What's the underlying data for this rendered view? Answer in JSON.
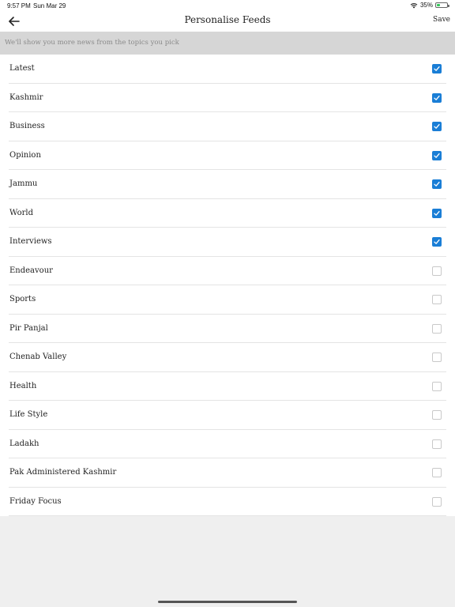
{
  "status_bar": {
    "time": "9:57 PM",
    "date": "Sun Mar 29",
    "battery": "35%",
    "battery_level": 0.35,
    "icons": [
      "wifi-icon",
      "battery-charging-icon"
    ]
  },
  "nav": {
    "title": "Personalise Feeds",
    "save_label": "Save",
    "back_icon": "arrow-left-icon"
  },
  "subtitle": "We'll show you more news from the topics you pick",
  "colors": {
    "checked": "#1a7ed6",
    "subtitle_bg": "#d6d6d6"
  },
  "topics": [
    {
      "label": "Latest",
      "checked": true
    },
    {
      "label": "Kashmir",
      "checked": true
    },
    {
      "label": "Business",
      "checked": true
    },
    {
      "label": "Opinion",
      "checked": true
    },
    {
      "label": "Jammu",
      "checked": true
    },
    {
      "label": "World",
      "checked": true
    },
    {
      "label": "Interviews",
      "checked": true
    },
    {
      "label": "Endeavour",
      "checked": false
    },
    {
      "label": "Sports",
      "checked": false
    },
    {
      "label": "Pir Panjal",
      "checked": false
    },
    {
      "label": "Chenab Valley",
      "checked": false
    },
    {
      "label": "Health",
      "checked": false
    },
    {
      "label": "Life Style",
      "checked": false
    },
    {
      "label": "Ladakh",
      "checked": false
    },
    {
      "label": "Pak Administered Kashmir",
      "checked": false
    },
    {
      "label": "Friday Focus",
      "checked": false
    }
  ]
}
